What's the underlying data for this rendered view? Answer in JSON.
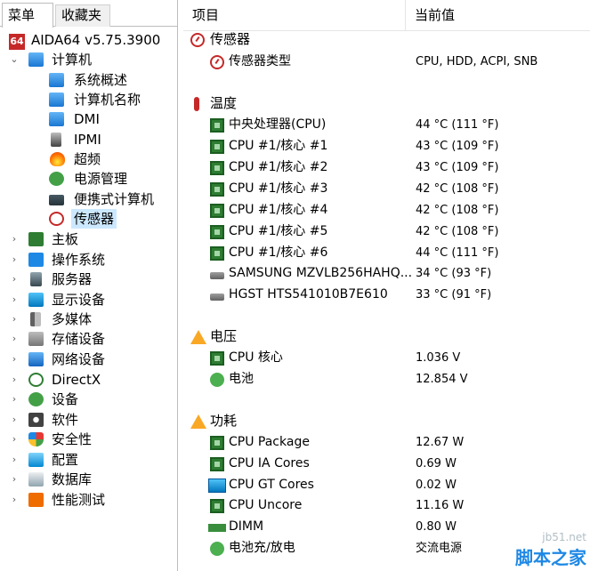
{
  "tabs": {
    "menu": "菜单",
    "favorites": "收藏夹"
  },
  "app": {
    "badge": "64",
    "title": "AIDA64 v5.75.3900"
  },
  "tree": {
    "computer": "计算机",
    "computer_children": [
      "系统概述",
      "计算机名称",
      "DMI",
      "IPMI",
      "超频",
      "电源管理",
      "便携式计算机",
      "传感器"
    ],
    "categories": [
      "主板",
      "操作系统",
      "服务器",
      "显示设备",
      "多媒体",
      "存储设备",
      "网络设备",
      "DirectX",
      "设备",
      "软件",
      "安全性",
      "配置",
      "数据库",
      "性能测试"
    ]
  },
  "columns": {
    "item": "项目",
    "value": "当前值"
  },
  "sections": {
    "sensor": {
      "title": "传感器",
      "rows": [
        {
          "name": "传感器类型",
          "value": "CPU, HDD, ACPI, SNB"
        }
      ]
    },
    "temperature": {
      "title": "温度",
      "rows": [
        {
          "name": "中央处理器(CPU)",
          "value": "44 °C  (111 °F)"
        },
        {
          "name": "CPU #1/核心 #1",
          "value": "43 °C  (109 °F)"
        },
        {
          "name": "CPU #1/核心 #2",
          "value": "43 °C  (109 °F)"
        },
        {
          "name": "CPU #1/核心 #3",
          "value": "42 °C  (108 °F)"
        },
        {
          "name": "CPU #1/核心 #4",
          "value": "42 °C  (108 °F)"
        },
        {
          "name": "CPU #1/核心 #5",
          "value": "42 °C  (108 °F)"
        },
        {
          "name": "CPU #1/核心 #6",
          "value": "44 °C  (111 °F)"
        },
        {
          "name": "SAMSUNG MZVLB256HAHQ...",
          "value": "34 °C  (93 °F)"
        },
        {
          "name": "HGST HTS541010B7E610",
          "value": "33 °C  (91 °F)"
        }
      ]
    },
    "voltage": {
      "title": "电压",
      "rows": [
        {
          "name": "CPU 核心",
          "value": "1.036 V"
        },
        {
          "name": "电池",
          "value": "12.854 V"
        }
      ]
    },
    "power": {
      "title": "功耗",
      "rows": [
        {
          "name": "CPU Package",
          "value": "12.67 W"
        },
        {
          "name": "CPU IA Cores",
          "value": "0.69 W"
        },
        {
          "name": "CPU GT Cores",
          "value": "0.02 W"
        },
        {
          "name": "CPU Uncore",
          "value": "11.16 W"
        },
        {
          "name": "DIMM",
          "value": "0.80 W"
        },
        {
          "name": "电池充/放电",
          "value": "交流电源"
        }
      ]
    }
  },
  "watermark": {
    "line1": "jb51.net",
    "line2": "脚本之家"
  }
}
